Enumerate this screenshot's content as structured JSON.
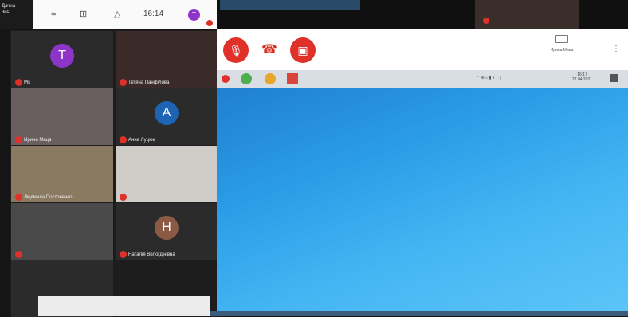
{
  "phone_status": {
    "app_title": "Дачна\nчас",
    "time": "16:14",
    "icons": [
      "signal-icon",
      "cast-icon",
      "warning-icon"
    ],
    "avatar_letter": "T",
    "avatar_color": "#8e35c9"
  },
  "participants": [
    {
      "name": "Ms",
      "avatar": "T",
      "avatar_color": "#8e35c9",
      "bg": "#2b2b2b"
    },
    {
      "name": "Тетяна Панфілова",
      "avatar": null,
      "bg": "#3a2b28"
    },
    {
      "name": "Ирина Мица",
      "avatar": null,
      "bg": "#6a5f60"
    },
    {
      "name": "Анна Луцюк",
      "avatar": "A",
      "avatar_color": "#1e64b4",
      "bg": "#2b2b2b"
    },
    {
      "name": "Людмила Постоненко",
      "avatar": null,
      "bg": "#8a7a62"
    },
    {
      "name": "",
      "avatar": null,
      "bg": "#cfcbc6"
    },
    {
      "name": "",
      "avatar": null,
      "bg": "#4a4a4a"
    },
    {
      "name": "Наталія Вологдінівна",
      "avatar": "H",
      "avatar_color": "#8a5a45",
      "bg": "#2b2b2b"
    },
    {
      "name": "",
      "avatar": null,
      "bg": "#2b2b2b"
    },
    {
      "name": "",
      "avatar": null,
      "bg": "#1d1d1d"
    }
  ],
  "meet": {
    "mic_label": "mic-off",
    "end_label": "end-call",
    "cam_label": "camera-off",
    "caption": "",
    "presenter": "Ирина Мица",
    "presenting_text": "",
    "top_tile_name": ""
  },
  "taskbar": {
    "time": "16:17",
    "date": "27.04.2021"
  },
  "colors": {
    "red": "#e0302a",
    "desktop": "#2b9ee8"
  }
}
